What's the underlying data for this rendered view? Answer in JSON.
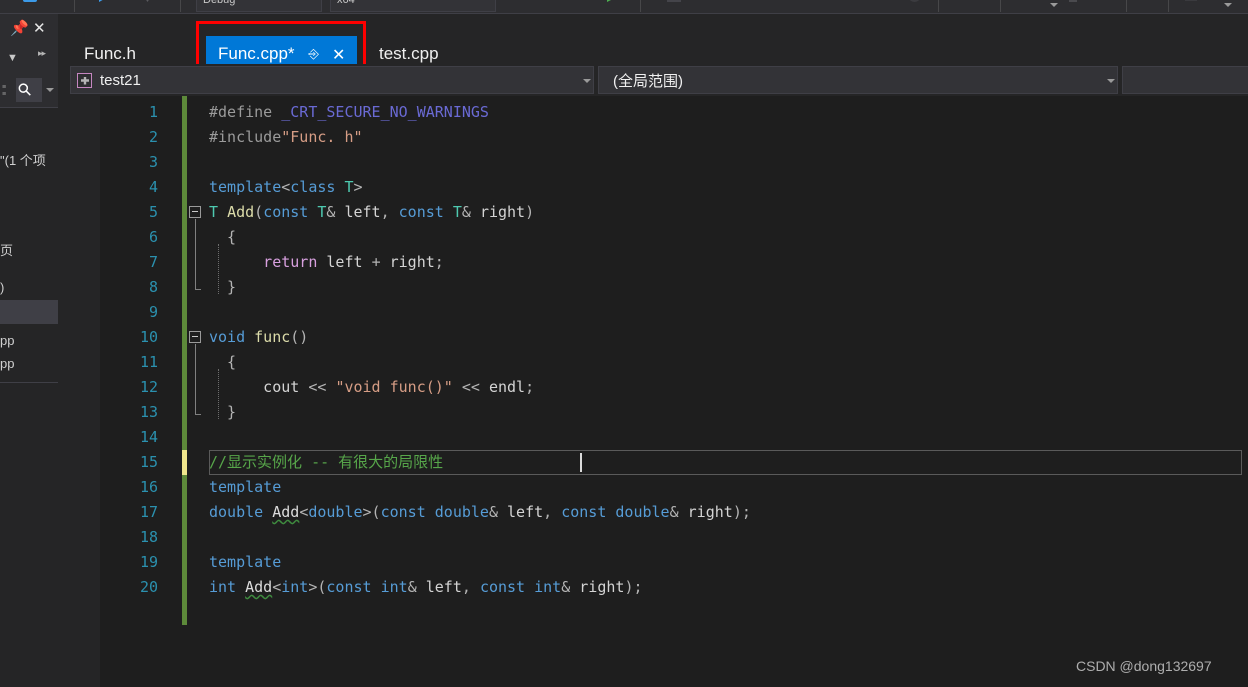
{
  "window": {
    "theme_bg": "#1e1e1e",
    "accent": "#0078d7",
    "annotation_color": "#fe0000"
  },
  "toolbar": {
    "combo_configuration": "Debug",
    "combo_platform": "x64",
    "separators": 8
  },
  "left_panel": {
    "pin_icon": "pin-icon",
    "close_icon": "close-icon",
    "chevron_icon": "chevron-down-icon",
    "overflow_icon": "overflow-chevrons-icon",
    "search_icon": "search-magnifier-icon",
    "search_caret_icon": "chevron-down-icon",
    "clipped_lines": [
      "\"(1 个项",
      "页",
      ")",
      "pp",
      "pp"
    ]
  },
  "tabs": [
    {
      "label": "Func.h",
      "active": false,
      "modified": false
    },
    {
      "label": "Func.cpp*",
      "active": true,
      "modified": true,
      "pin_icon": "pin-icon",
      "close_icon": "close-icon"
    },
    {
      "label": "test.cpp",
      "active": false,
      "modified": false
    }
  ],
  "navbar": {
    "project_selector": "test21",
    "project_icon": "project-puzzle-icon",
    "scope_selector": "(全局范围)",
    "caret_icon": "chevron-down-icon"
  },
  "editor": {
    "current_line": 15,
    "lines": [
      {
        "n": 1,
        "text": "#define _CRT_SECURE_NO_WARNINGS"
      },
      {
        "n": 2,
        "text": "#include\"Func. h\""
      },
      {
        "n": 3,
        "text": ""
      },
      {
        "n": 4,
        "text": "template<class T>"
      },
      {
        "n": 5,
        "text": "T Add(const T& left, const T& right)"
      },
      {
        "n": 6,
        "text": "{"
      },
      {
        "n": 7,
        "text": "    return left + right;"
      },
      {
        "n": 8,
        "text": "}"
      },
      {
        "n": 9,
        "text": ""
      },
      {
        "n": 10,
        "text": "void func()"
      },
      {
        "n": 11,
        "text": "{"
      },
      {
        "n": 12,
        "text": "    cout << \"void func()\" << endl;"
      },
      {
        "n": 13,
        "text": "}"
      },
      {
        "n": 14,
        "text": ""
      },
      {
        "n": 15,
        "text": "//显示实例化 -- 有很大的局限性"
      },
      {
        "n": 16,
        "text": "template"
      },
      {
        "n": 17,
        "text": "double Add<double>(const double& left, const double& right);"
      },
      {
        "n": 18,
        "text": ""
      },
      {
        "n": 19,
        "text": "template"
      },
      {
        "n": 20,
        "text": "int Add<int>(const int& left, const int& right);"
      }
    ]
  },
  "watermark": {
    "text": "CSDN @dong132697"
  }
}
